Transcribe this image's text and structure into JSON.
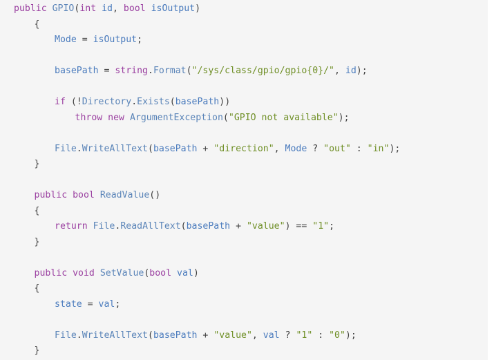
{
  "editor": {
    "background": "#f5f5f5",
    "page_background": "#ffffff",
    "language": "csharp",
    "colors": {
      "keyword": "#9a3fa0",
      "type": "#5a84b8",
      "method": "#5a84b8",
      "identifier": "#4a7bbd",
      "string": "#6f8f26",
      "punctuation": "#3f3f3f"
    }
  },
  "code": {
    "lines": [
      {
        "indent": 0,
        "tokens": [
          {
            "t": "public",
            "c": "kw"
          },
          {
            "t": " ",
            "c": "punct"
          },
          {
            "t": "GPIO",
            "c": "type"
          },
          {
            "t": "(",
            "c": "punct"
          },
          {
            "t": "int",
            "c": "kw"
          },
          {
            "t": " ",
            "c": "punct"
          },
          {
            "t": "id",
            "c": "id"
          },
          {
            "t": ", ",
            "c": "punct"
          },
          {
            "t": "bool",
            "c": "kw"
          },
          {
            "t": " ",
            "c": "punct"
          },
          {
            "t": "isOutput",
            "c": "id"
          },
          {
            "t": ")",
            "c": "punct"
          }
        ]
      },
      {
        "indent": 1,
        "tokens": [
          {
            "t": "{",
            "c": "brace"
          }
        ]
      },
      {
        "indent": 2,
        "tokens": [
          {
            "t": "Mode",
            "c": "id"
          },
          {
            "t": " = ",
            "c": "op"
          },
          {
            "t": "isOutput",
            "c": "id"
          },
          {
            "t": ";",
            "c": "punct"
          }
        ]
      },
      {
        "indent": 0,
        "tokens": []
      },
      {
        "indent": 2,
        "tokens": [
          {
            "t": "basePath",
            "c": "id"
          },
          {
            "t": " = ",
            "c": "op"
          },
          {
            "t": "string",
            "c": "kw"
          },
          {
            "t": ".",
            "c": "punct"
          },
          {
            "t": "Format",
            "c": "fn"
          },
          {
            "t": "(",
            "c": "punct"
          },
          {
            "t": "\"/sys/class/gpio/gpio{0}/\"",
            "c": "str"
          },
          {
            "t": ", ",
            "c": "punct"
          },
          {
            "t": "id",
            "c": "id"
          },
          {
            "t": ");",
            "c": "punct"
          }
        ]
      },
      {
        "indent": 0,
        "tokens": []
      },
      {
        "indent": 2,
        "tokens": [
          {
            "t": "if",
            "c": "kw"
          },
          {
            "t": " (!",
            "c": "punct"
          },
          {
            "t": "Directory",
            "c": "type"
          },
          {
            "t": ".",
            "c": "punct"
          },
          {
            "t": "Exists",
            "c": "fn"
          },
          {
            "t": "(",
            "c": "punct"
          },
          {
            "t": "basePath",
            "c": "id"
          },
          {
            "t": "))",
            "c": "punct"
          }
        ]
      },
      {
        "indent": 3,
        "tokens": [
          {
            "t": "throw",
            "c": "kw"
          },
          {
            "t": " ",
            "c": "punct"
          },
          {
            "t": "new",
            "c": "kw"
          },
          {
            "t": " ",
            "c": "punct"
          },
          {
            "t": "ArgumentException",
            "c": "type"
          },
          {
            "t": "(",
            "c": "punct"
          },
          {
            "t": "\"GPIO not available\"",
            "c": "str"
          },
          {
            "t": ");",
            "c": "punct"
          }
        ]
      },
      {
        "indent": 0,
        "tokens": []
      },
      {
        "indent": 2,
        "tokens": [
          {
            "t": "File",
            "c": "type"
          },
          {
            "t": ".",
            "c": "punct"
          },
          {
            "t": "WriteAllText",
            "c": "fn"
          },
          {
            "t": "(",
            "c": "punct"
          },
          {
            "t": "basePath",
            "c": "id"
          },
          {
            "t": " + ",
            "c": "op"
          },
          {
            "t": "\"direction\"",
            "c": "str"
          },
          {
            "t": ", ",
            "c": "punct"
          },
          {
            "t": "Mode",
            "c": "id"
          },
          {
            "t": " ? ",
            "c": "op"
          },
          {
            "t": "\"out\"",
            "c": "str"
          },
          {
            "t": " : ",
            "c": "op"
          },
          {
            "t": "\"in\"",
            "c": "str"
          },
          {
            "t": ");",
            "c": "punct"
          }
        ]
      },
      {
        "indent": 1,
        "tokens": [
          {
            "t": "}",
            "c": "brace"
          }
        ]
      },
      {
        "indent": 0,
        "tokens": []
      },
      {
        "indent": 1,
        "tokens": [
          {
            "t": "public",
            "c": "kw"
          },
          {
            "t": " ",
            "c": "punct"
          },
          {
            "t": "bool",
            "c": "kw"
          },
          {
            "t": " ",
            "c": "punct"
          },
          {
            "t": "ReadValue",
            "c": "fn"
          },
          {
            "t": "()",
            "c": "punct"
          }
        ]
      },
      {
        "indent": 1,
        "tokens": [
          {
            "t": "{",
            "c": "brace"
          }
        ]
      },
      {
        "indent": 2,
        "tokens": [
          {
            "t": "return",
            "c": "kw"
          },
          {
            "t": " ",
            "c": "punct"
          },
          {
            "t": "File",
            "c": "type"
          },
          {
            "t": ".",
            "c": "punct"
          },
          {
            "t": "ReadAllText",
            "c": "fn"
          },
          {
            "t": "(",
            "c": "punct"
          },
          {
            "t": "basePath",
            "c": "id"
          },
          {
            "t": " + ",
            "c": "op"
          },
          {
            "t": "\"value\"",
            "c": "str"
          },
          {
            "t": ") == ",
            "c": "op"
          },
          {
            "t": "\"1\"",
            "c": "str"
          },
          {
            "t": ";",
            "c": "punct"
          }
        ]
      },
      {
        "indent": 1,
        "tokens": [
          {
            "t": "}",
            "c": "brace"
          }
        ]
      },
      {
        "indent": 0,
        "tokens": []
      },
      {
        "indent": 1,
        "tokens": [
          {
            "t": "public",
            "c": "kw"
          },
          {
            "t": " ",
            "c": "punct"
          },
          {
            "t": "void",
            "c": "kw"
          },
          {
            "t": " ",
            "c": "punct"
          },
          {
            "t": "SetValue",
            "c": "fn"
          },
          {
            "t": "(",
            "c": "punct"
          },
          {
            "t": "bool",
            "c": "kw"
          },
          {
            "t": " ",
            "c": "punct"
          },
          {
            "t": "val",
            "c": "id"
          },
          {
            "t": ")",
            "c": "punct"
          }
        ]
      },
      {
        "indent": 1,
        "tokens": [
          {
            "t": "{",
            "c": "brace"
          }
        ]
      },
      {
        "indent": 2,
        "tokens": [
          {
            "t": "state",
            "c": "id"
          },
          {
            "t": " = ",
            "c": "op"
          },
          {
            "t": "val",
            "c": "id"
          },
          {
            "t": ";",
            "c": "punct"
          }
        ]
      },
      {
        "indent": 0,
        "tokens": []
      },
      {
        "indent": 2,
        "tokens": [
          {
            "t": "File",
            "c": "type"
          },
          {
            "t": ".",
            "c": "punct"
          },
          {
            "t": "WriteAllText",
            "c": "fn"
          },
          {
            "t": "(",
            "c": "punct"
          },
          {
            "t": "basePath",
            "c": "id"
          },
          {
            "t": " + ",
            "c": "op"
          },
          {
            "t": "\"value\"",
            "c": "str"
          },
          {
            "t": ", ",
            "c": "punct"
          },
          {
            "t": "val",
            "c": "id"
          },
          {
            "t": " ? ",
            "c": "op"
          },
          {
            "t": "\"1\"",
            "c": "str"
          },
          {
            "t": " : ",
            "c": "op"
          },
          {
            "t": "\"0\"",
            "c": "str"
          },
          {
            "t": ");",
            "c": "punct"
          }
        ]
      },
      {
        "indent": 1,
        "tokens": [
          {
            "t": "}",
            "c": "brace"
          }
        ]
      }
    ]
  }
}
